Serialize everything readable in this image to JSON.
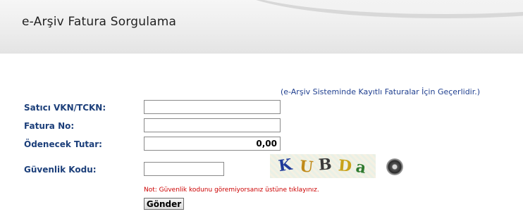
{
  "header": {
    "title": "e-Arşiv Fatura Sorgulama"
  },
  "form": {
    "note": "(e-Arşiv Sisteminde Kayıtlı Faturalar İçin Geçerlidir.)",
    "fields": {
      "seller_id": {
        "label": "Satıcı VKN/TCKN:",
        "value": ""
      },
      "invoice_no": {
        "label": "Fatura No:",
        "value": ""
      },
      "amount": {
        "label": "Ödenecek Tutar:",
        "value": "0,00"
      },
      "security_code": {
        "label": "Güvenlik Kodu:",
        "value": ""
      }
    },
    "captcha": {
      "chars": [
        "K",
        "U",
        "B",
        "D",
        "a"
      ],
      "colors": [
        "#1f3a9a",
        "#c08a1a",
        "#3a3a3a",
        "#c8a21a",
        "#2f7a2f"
      ]
    },
    "refresh_icon": "refresh-icon",
    "warning": "Not: Güvenlik kodunu göremiyorsanız üstüne tıklayınız.",
    "submit_label": "Gönder"
  }
}
